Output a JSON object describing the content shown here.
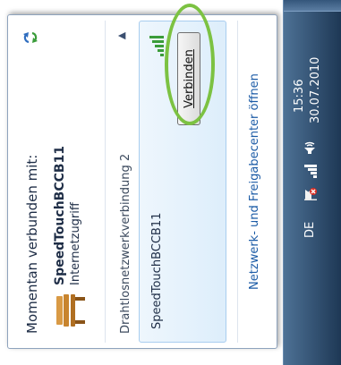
{
  "popup": {
    "connected_label": "Momentan verbunden mit:",
    "connection": {
      "name": "SpeedTouchBCCB11",
      "status": "Internetzugriff",
      "icon": "bench-network-icon"
    },
    "group_header": "Drahtlosnetzwerkverbindung 2",
    "network_item": {
      "name": "SpeedTouchBCCB11",
      "connect_label": "Verbinden",
      "signal_icon": "signal-bars-icon"
    },
    "footer_link": "Netzwerk- und Freigabecenter öffnen"
  },
  "taskbar": {
    "language": "DE",
    "time": "15:36",
    "date": "30.07.2010"
  },
  "colors": {
    "highlight_ring": "#7cc242",
    "link": "#1b5ba6",
    "taskbar": "#2b4a6d"
  }
}
